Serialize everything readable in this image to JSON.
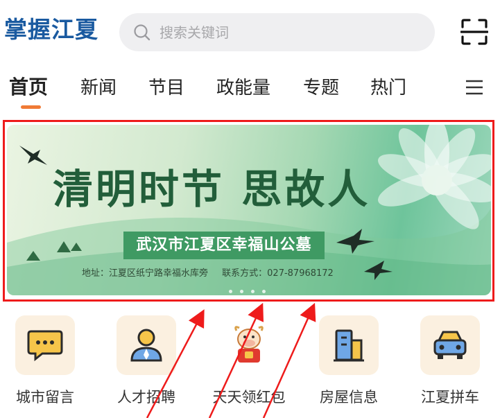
{
  "header": {
    "logo_text": "掌握江夏",
    "search_placeholder": "搜索关键词",
    "scan_icon": "scan-icon"
  },
  "tabs": [
    {
      "label": "首页",
      "active": true
    },
    {
      "label": "新闻"
    },
    {
      "label": "节目"
    },
    {
      "label": "政能量"
    },
    {
      "label": "专题"
    },
    {
      "label": "热门"
    }
  ],
  "banner": {
    "headline": "清明时节 思故人",
    "plate": "武汉市江夏区幸福山公墓",
    "address": "地址：江夏区纸宁路幸福水库旁",
    "contact": "联系方式：027-87968172",
    "highlight_color": "#ee1b1b"
  },
  "services": [
    {
      "label": "城市留言",
      "icon": "message-icon"
    },
    {
      "label": "人才招聘",
      "icon": "person-icon"
    },
    {
      "label": "天天领红包",
      "icon": "cow-mascot-icon"
    },
    {
      "label": "房屋信息",
      "icon": "building-icon"
    },
    {
      "label": "江夏拼车",
      "icon": "car-icon"
    }
  ],
  "colors": {
    "accent": "#f07a35",
    "logo": "#1a5aa0",
    "icon_tile": "#fbf0e0"
  }
}
